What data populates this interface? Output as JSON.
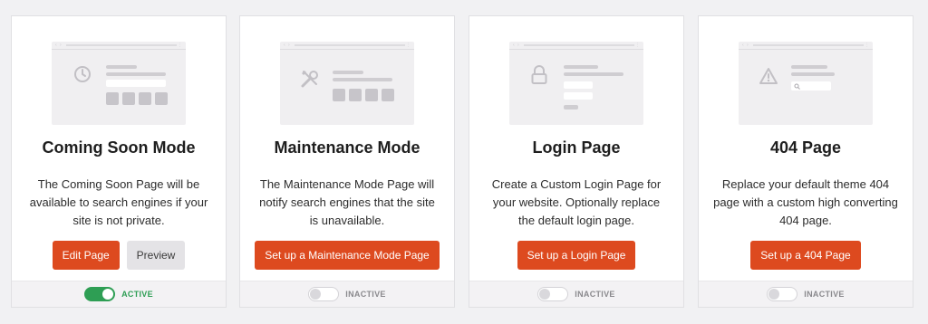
{
  "colors": {
    "accent": "#dd4a1f",
    "active_green": "#2e9e54",
    "inactive_gray": "#8a898d",
    "page_bg": "#f1f1f3"
  },
  "cards": [
    {
      "title": "Coming Soon Mode",
      "illustration_icon": "clock-icon",
      "description": "The Coming Soon Page will be available to search engines if your site is not private.",
      "primary_button": "Edit Page",
      "secondary_button": "Preview",
      "toggle_on": true,
      "status": "ACTIVE"
    },
    {
      "title": "Maintenance Mode",
      "illustration_icon": "tools-icon",
      "description": "The Maintenance Mode Page will notify search engines that the site is unavailable.",
      "primary_button": "Set up a Maintenance Mode Page",
      "toggle_on": false,
      "status": "INACTIVE"
    },
    {
      "title": "Login Page",
      "illustration_icon": "lock-icon",
      "description": "Create a Custom Login Page for your website. Optionally replace the default login page.",
      "primary_button": "Set up a Login Page",
      "toggle_on": false,
      "status": "INACTIVE"
    },
    {
      "title": "404 Page",
      "illustration_icon": "warning-icon",
      "description": "Replace your default theme 404 page with a custom high converting 404 page.",
      "primary_button": "Set up a 404 Page",
      "toggle_on": false,
      "status": "INACTIVE"
    }
  ]
}
